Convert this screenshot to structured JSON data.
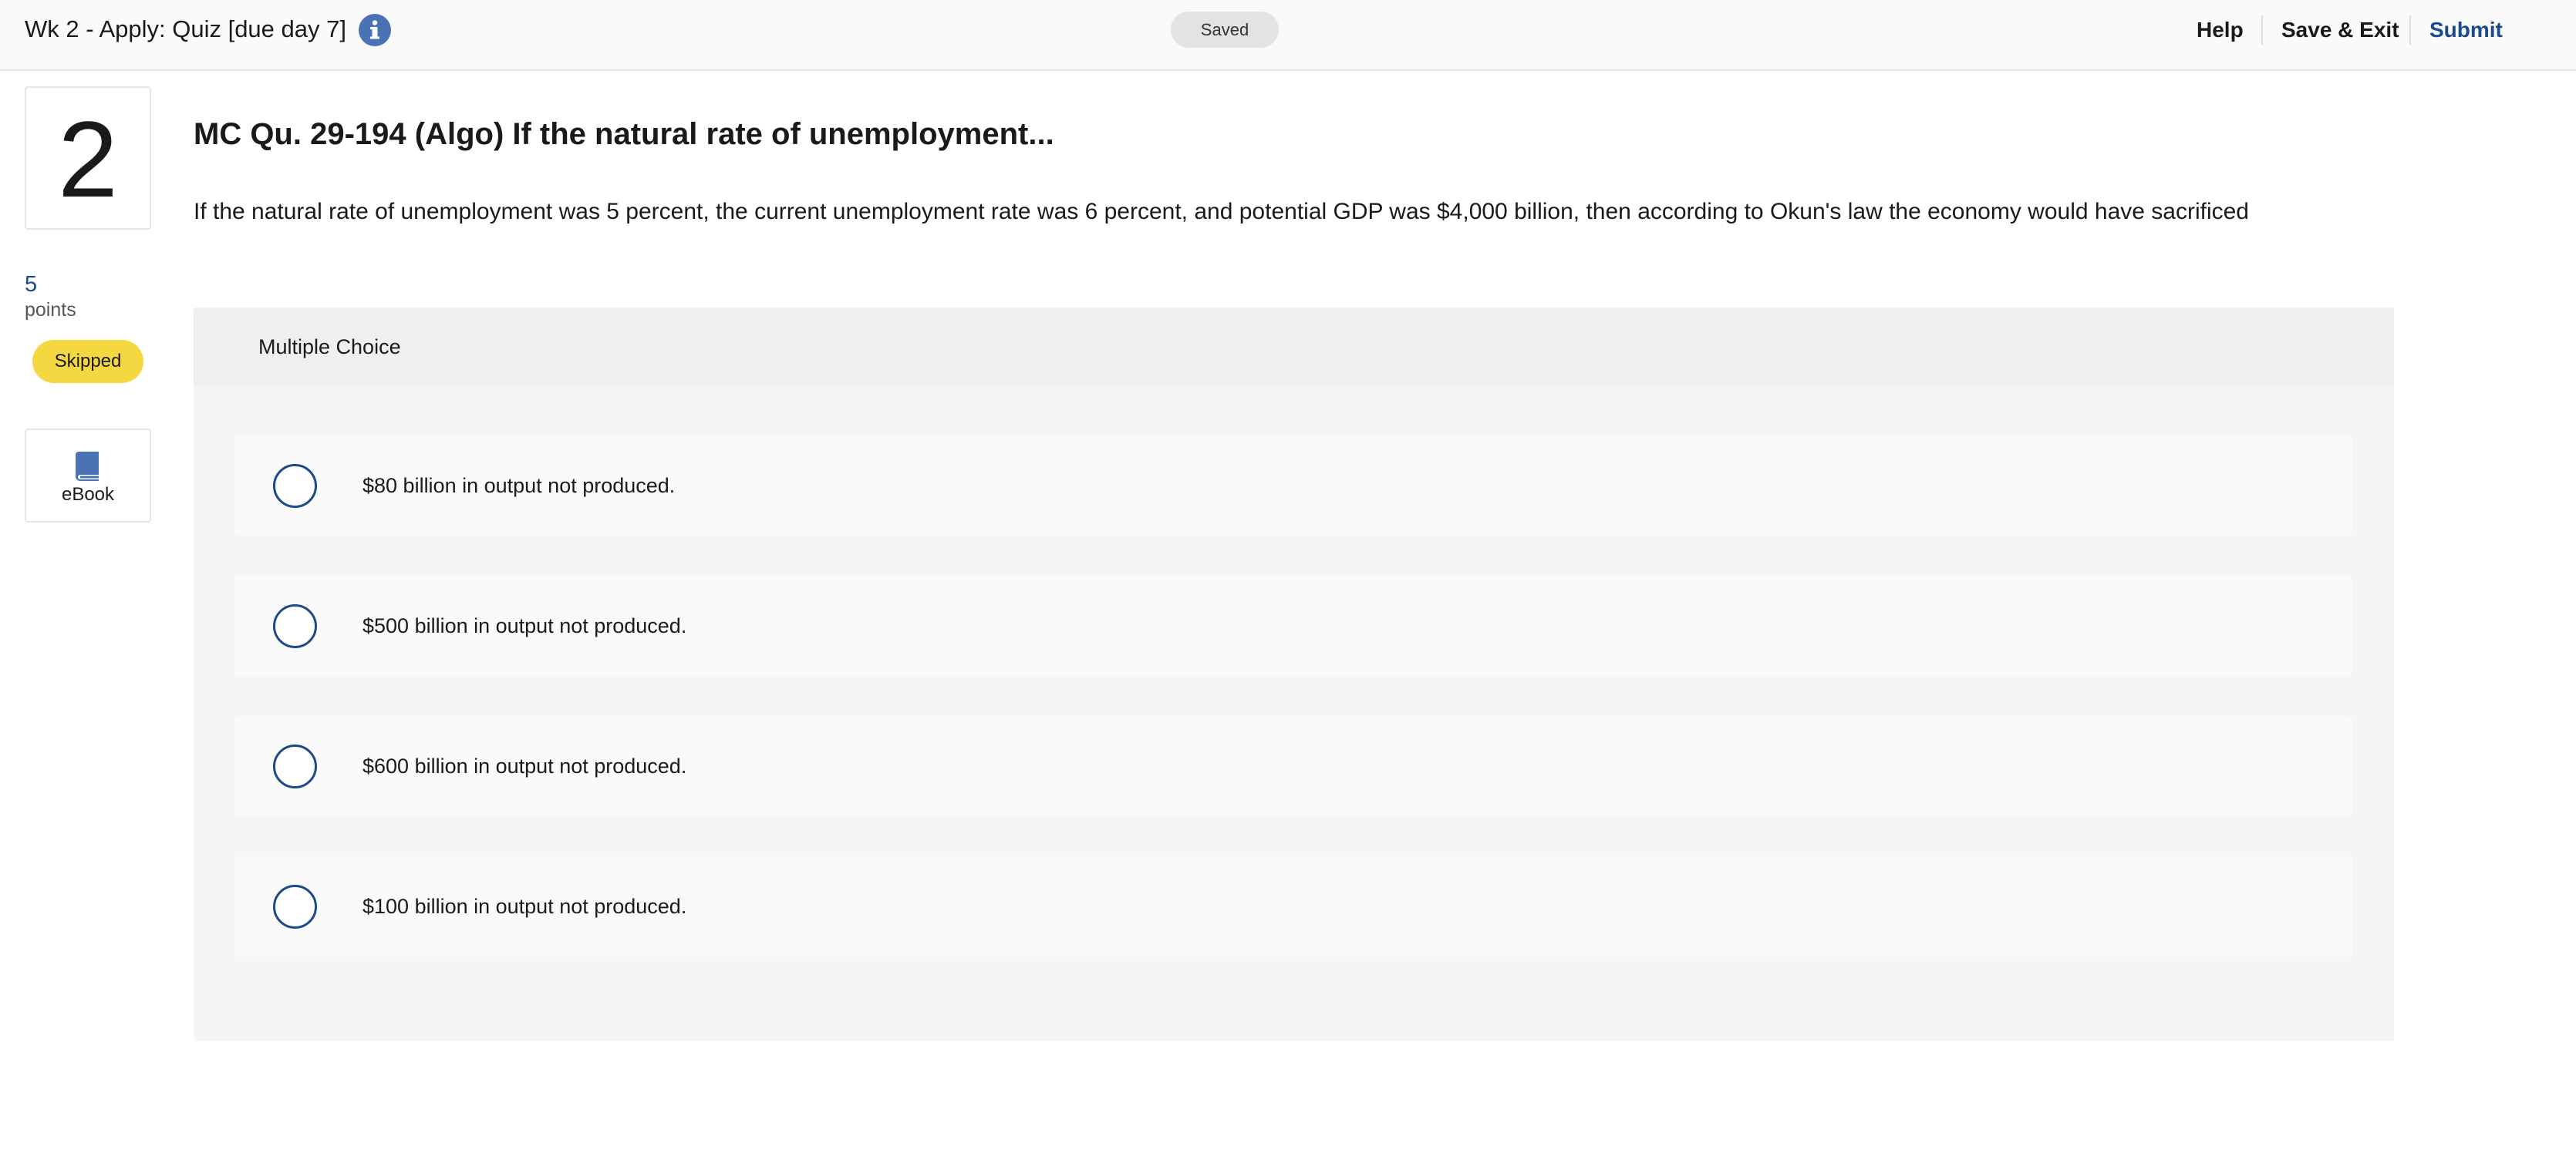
{
  "header": {
    "title": "Wk 2 - Apply: Quiz [due day 7]",
    "info_icon": "info-icon",
    "status": "Saved",
    "help_label": "Help",
    "save_exit_label": "Save & Exit",
    "submit_label": "Submit"
  },
  "sidebar": {
    "question_number": "2",
    "points_value": "5",
    "points_label": "points",
    "status_badge": "Skipped",
    "ebook_icon": "book-icon",
    "ebook_label": "eBook"
  },
  "question": {
    "title": "MC Qu. 29-194 (Algo) If the natural rate of unemployment...",
    "text": "If the natural rate of unemployment was 5 percent, the current unemployment rate was 6 percent, and potential GDP was $4,000 billion, then according to Okun's law the economy would have sacrificed",
    "type_label": "Multiple Choice",
    "choices": [
      {
        "label": "$80 billion in output not produced."
      },
      {
        "label": "$500 billion in output not produced."
      },
      {
        "label": "$600 billion in output not produced."
      },
      {
        "label": "$100 billion in output not produced."
      }
    ]
  },
  "colors": {
    "accent": "#1a4a8a",
    "info_icon": "#4a72b5",
    "skipped_badge": "#f5d742",
    "saved_pill": "#e3e3e3"
  }
}
